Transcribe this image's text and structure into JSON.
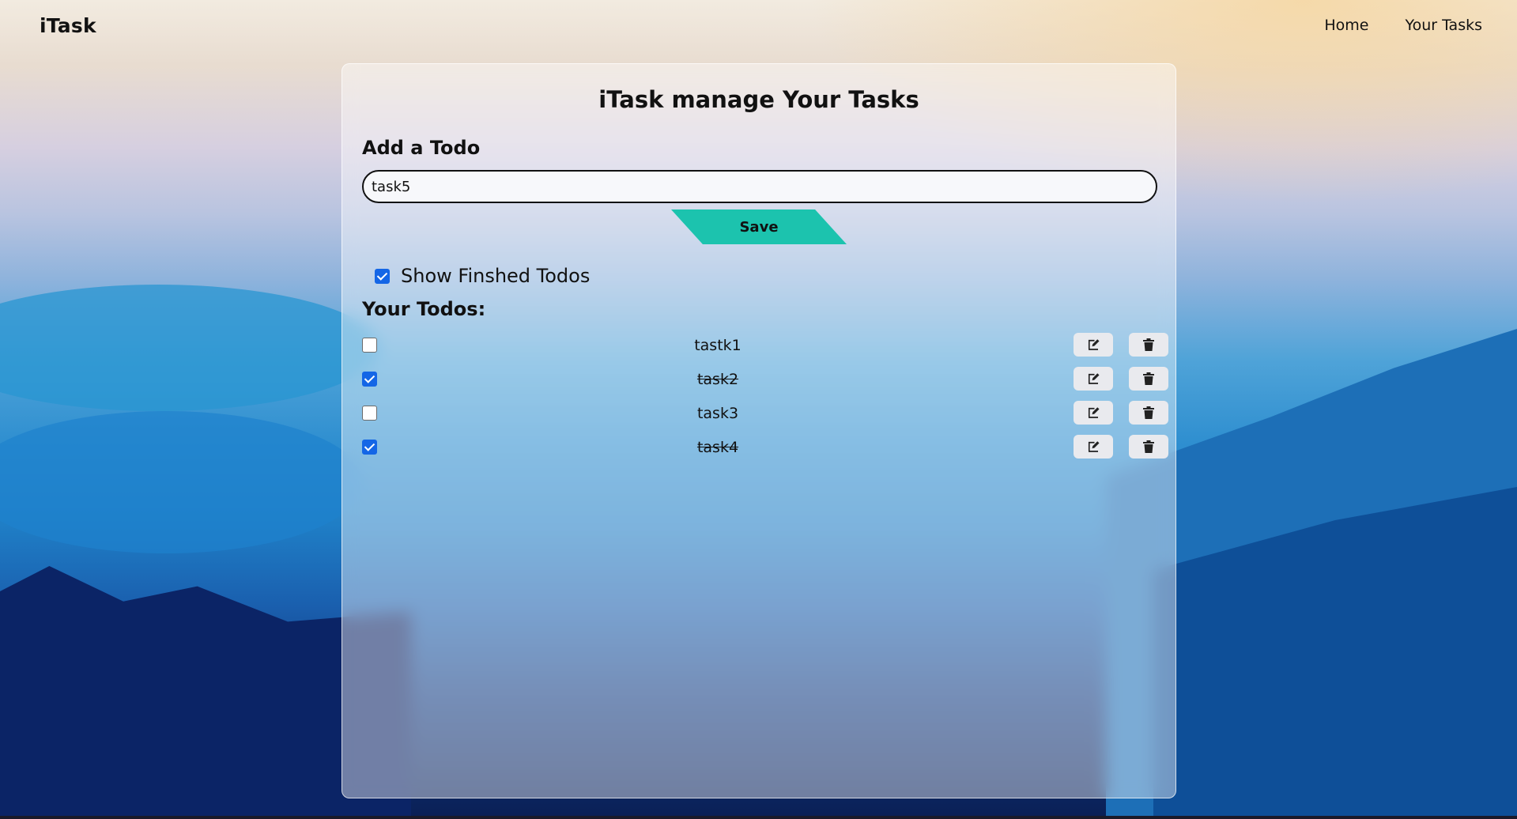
{
  "nav": {
    "brand": "iTask",
    "links": [
      "Home",
      "Your Tasks"
    ]
  },
  "card": {
    "title": "iTask manage Your Tasks",
    "add_heading": "Add a Todo",
    "input_value": "task5",
    "save_label": "Save",
    "show_finished_label": "Show Finshed Todos",
    "show_finished_checked": true,
    "todos_heading": "Your Todos:",
    "todos": [
      {
        "text": "tastk1",
        "done": false
      },
      {
        "text": "task2",
        "done": true
      },
      {
        "text": "task3",
        "done": false
      },
      {
        "text": "task4",
        "done": true
      }
    ]
  },
  "colors": {
    "accent": "#1cc3ae",
    "checkbox": "#1466e6"
  },
  "icons": {
    "edit": "edit-icon",
    "delete": "trash-icon"
  }
}
